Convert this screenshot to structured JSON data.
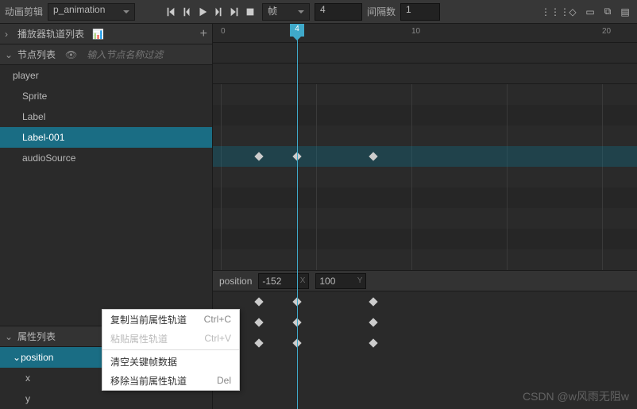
{
  "topbar": {
    "title_label": "动画剪辑",
    "clip_name": "p_animation",
    "frame_label": "帧",
    "frame_value": "4",
    "interval_label": "间隔数",
    "interval_value": "1"
  },
  "ruler": {
    "ticks": [
      0,
      4,
      10,
      20
    ],
    "playhead": 4
  },
  "sections": {
    "player_tracks": "播放器轨道列表",
    "node_list": "节点列表",
    "filter_placeholder": "输入节点名称过滤",
    "prop_list": "属性列表"
  },
  "tree": {
    "items": [
      {
        "label": "player",
        "depth": 0,
        "sel": false
      },
      {
        "label": "Sprite",
        "depth": 1,
        "sel": false
      },
      {
        "label": "Label",
        "depth": 1,
        "sel": false
      },
      {
        "label": "Label-001",
        "depth": 1,
        "sel": true
      },
      {
        "label": "audioSource",
        "depth": 1,
        "sel": false
      }
    ]
  },
  "props": {
    "header_name": "position",
    "x_value": "-152",
    "y_value": "100",
    "items": [
      {
        "label": "position",
        "sel": true
      },
      {
        "label": "x",
        "sel": false,
        "sub": true
      },
      {
        "label": "y",
        "sel": false,
        "sub": true
      }
    ]
  },
  "keyframes": {
    "label001": [
      2,
      4,
      8
    ],
    "position": [
      2,
      4,
      8
    ],
    "x": [
      2,
      4,
      8
    ],
    "y": [
      2,
      4,
      8
    ]
  },
  "context_menu": {
    "items": [
      {
        "label": "复制当前属性轨道",
        "shortcut": "Ctrl+C"
      },
      {
        "label": "粘贴属性轨道",
        "shortcut": "Ctrl+V",
        "disabled": true
      },
      {
        "sep": true
      },
      {
        "label": "清空关键帧数据",
        "shortcut": ""
      },
      {
        "label": "移除当前属性轨道",
        "shortcut": "Del"
      }
    ]
  },
  "watermark": "CSDN @w风雨无阻w"
}
